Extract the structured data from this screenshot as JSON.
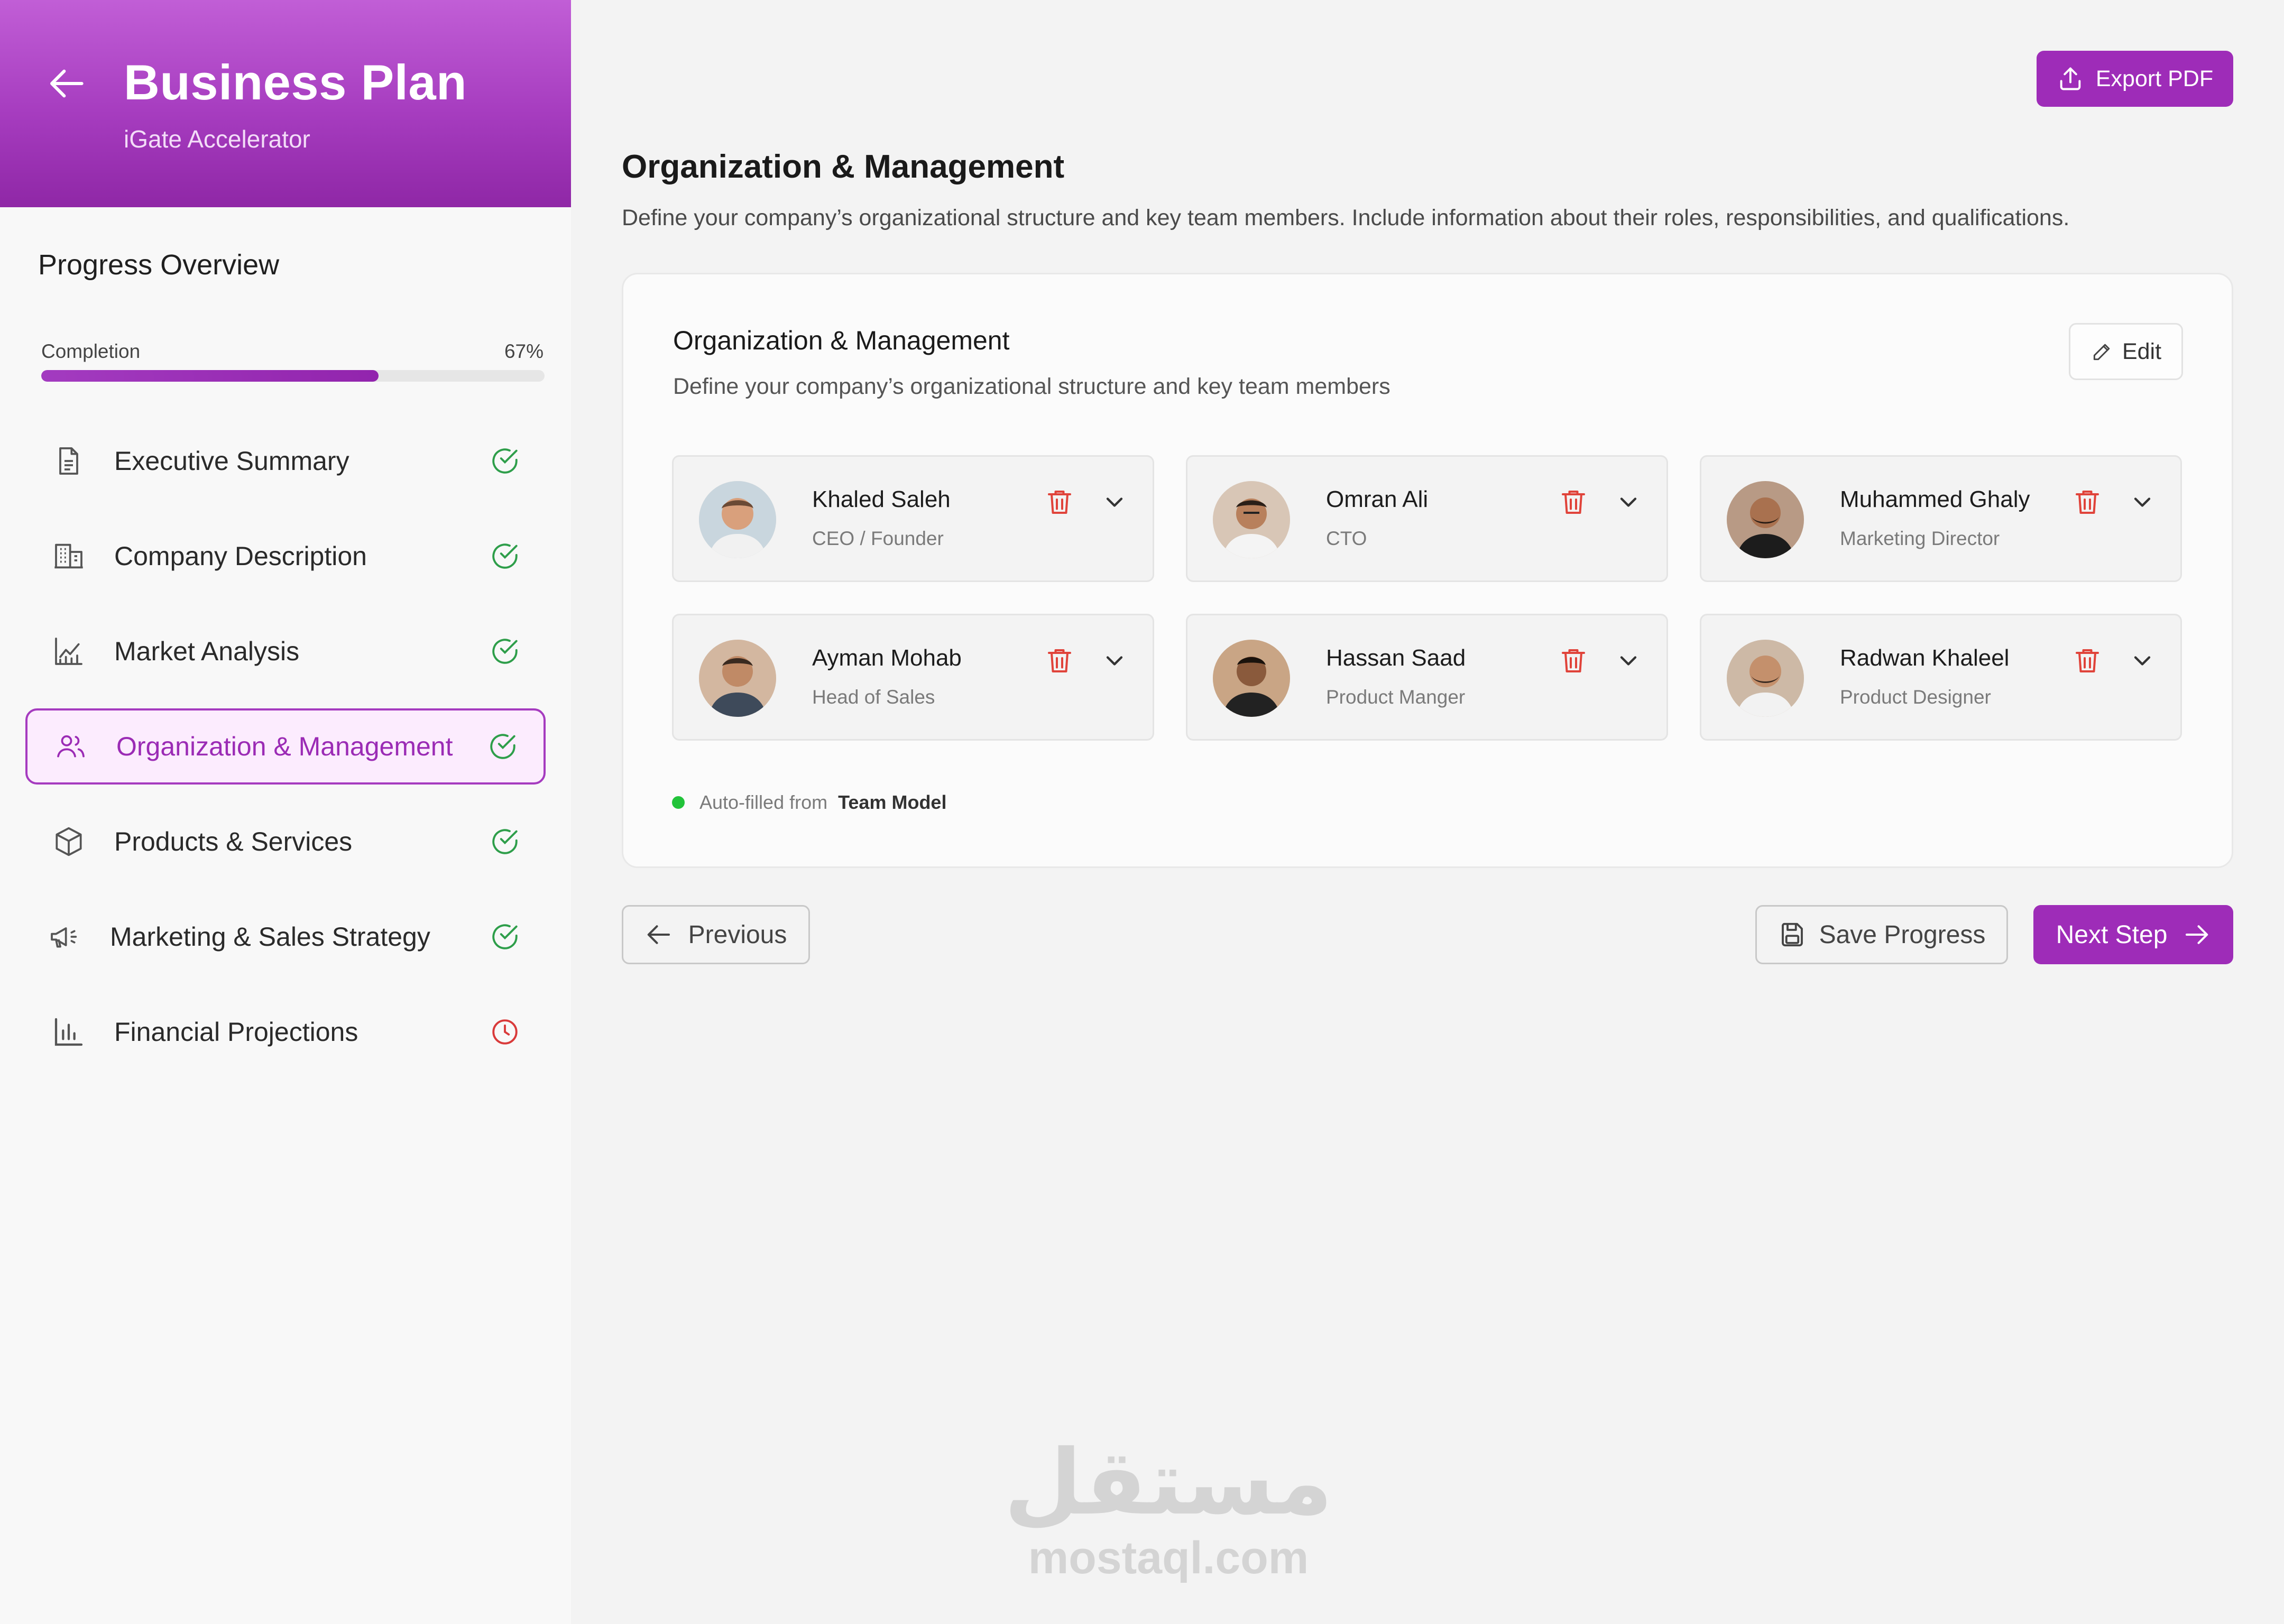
{
  "sidebar": {
    "title": "Business Plan",
    "subtitle": "iGate Accelerator",
    "progress_title": "Progress Overview",
    "completion_label": "Completion",
    "completion_value": "67%",
    "completion_fraction": 0.67,
    "items": [
      {
        "label": "Executive Summary",
        "icon": "document-icon",
        "status": "complete"
      },
      {
        "label": "Company Description",
        "icon": "building-icon",
        "status": "complete"
      },
      {
        "label": "Market Analysis",
        "icon": "chart-trend-icon",
        "status": "complete"
      },
      {
        "label": "Organization & Management",
        "icon": "users-icon",
        "status": "complete",
        "active": true
      },
      {
        "label": "Products & Services",
        "icon": "box-icon",
        "status": "complete"
      },
      {
        "label": "Marketing & Sales Strategy",
        "icon": "megaphone-icon",
        "status": "complete"
      },
      {
        "label": "Financial Projections",
        "icon": "bar-chart-icon",
        "status": "pending"
      }
    ]
  },
  "header": {
    "export_label": "Export PDF"
  },
  "main": {
    "title": "Organization & Management",
    "description": "Define your company’s organizational structure and key team members. Include information about their roles, responsibilities, and qualifications."
  },
  "card": {
    "title": "Organization & Management",
    "description": "Define your company’s organizational structure and key team members",
    "edit_label": "Edit",
    "members": [
      {
        "name": "Khaled Saleh",
        "role": "CEO / Founder"
      },
      {
        "name": "Omran Ali",
        "role": "CTO"
      },
      {
        "name": "Muhammed Ghaly",
        "role": "Marketing Director"
      },
      {
        "name": "Ayman Mohab",
        "role": "Head of Sales"
      },
      {
        "name": "Hassan Saad",
        "role": "Product Manger"
      },
      {
        "name": "Radwan Khaleel",
        "role": "Product Designer"
      }
    ],
    "auto_filled_prefix": "Auto-filled from",
    "auto_filled_source": "Team Model"
  },
  "footer": {
    "previous_label": "Previous",
    "save_label": "Save Progress",
    "next_label": "Next Step"
  },
  "watermark": {
    "arabic": "مستقل",
    "latin": "mostaql.com"
  },
  "colors": {
    "accent": "#9e2cb8",
    "complete": "#2e9e4a",
    "pending": "#d93a3a",
    "delete": "#e0433a"
  }
}
